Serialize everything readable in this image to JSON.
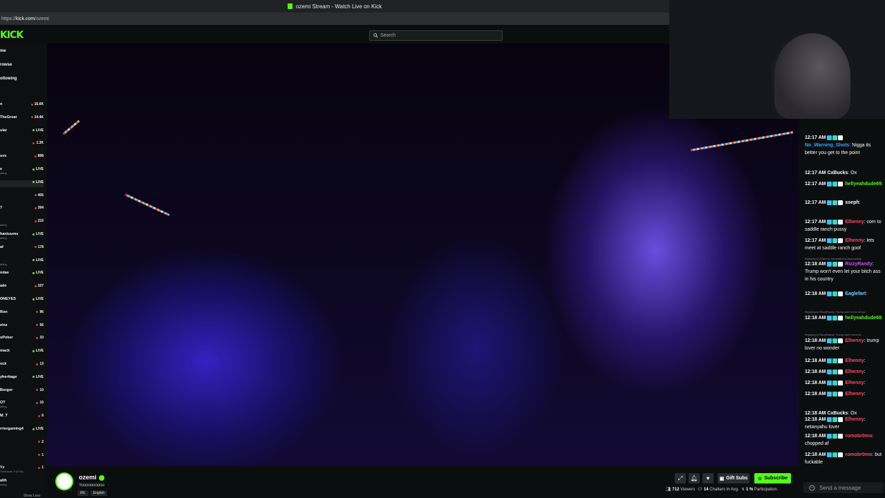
{
  "browser": {
    "title": "ozemi Stream - Watch Live on Kick",
    "url_prefix": "https://",
    "url_host": "kick.com",
    "url_path": "/ozemi"
  },
  "header": {
    "logo": "KICK",
    "search_placeholder": "Search"
  },
  "sidebar": {
    "nav": [
      "me",
      "rowse",
      "ollowing"
    ],
    "channels": [
      {
        "name": "n",
        "sub": "",
        "count": "16.6K",
        "dot": "red"
      },
      {
        "name": "TheGreat",
        "sub": "",
        "count": "14.4K",
        "dot": "red"
      },
      {
        "name": "ular",
        "sub": "",
        "count": "LIVE",
        "dot": "green"
      },
      {
        "name": "",
        "sub": "",
        "count": "1.3K",
        "dot": "red"
      },
      {
        "name": "uvs",
        "sub": "",
        "count": "898",
        "dot": "red"
      },
      {
        "name": "e",
        "sub": "atting",
        "count": "LIVE",
        "dot": "green"
      },
      {
        "name": "",
        "sub": "",
        "count": "LIVE",
        "dot": "green"
      },
      {
        "name": "",
        "sub": "",
        "count": "405",
        "dot": "red"
      },
      {
        "name": "7",
        "sub": "",
        "count": "394",
        "dot": "red"
      },
      {
        "name": "",
        "sub": "atting",
        "count": "215",
        "dot": "red"
      },
      {
        "name": "hantuums",
        "sub": "atting",
        "count": "LIVE",
        "dot": "green"
      },
      {
        "name": "af",
        "sub": "",
        "count": "178",
        "dot": "red"
      },
      {
        "name": "",
        "sub": "atting",
        "count": "LIVE",
        "dot": "green"
      },
      {
        "name": "ndas",
        "sub": "",
        "count": "LIVE",
        "dot": "green"
      },
      {
        "name": "ade",
        "sub": "",
        "count": "107",
        "dot": "red"
      },
      {
        "name": "ONEYES",
        "sub": "",
        "count": "LIVE",
        "dot": "green"
      },
      {
        "name": "Ron",
        "sub": "",
        "count": "96",
        "dot": "red"
      },
      {
        "name": "einz",
        "sub": "",
        "count": "56",
        "dot": "red"
      },
      {
        "name": "oPoker",
        "sub": "",
        "count": "33",
        "dot": "red"
      },
      {
        "name": "mack",
        "sub": "",
        "count": "LIVE",
        "dot": "green"
      },
      {
        "name": "ock",
        "sub": "",
        "count": "13",
        "dot": "red"
      },
      {
        "name": "yheritage",
        "sub": "",
        "count": "LIVE",
        "dot": "green"
      },
      {
        "name": "Borgor",
        "sub": "",
        "count": "10",
        "dot": "red"
      },
      {
        "name": "OT",
        "sub": "atting",
        "count": "10",
        "dot": "red"
      },
      {
        "name": "M_T",
        "sub": "",
        "count": "6",
        "dot": "red"
      },
      {
        "name": "rriorgaming4",
        "sub": "",
        "count": "LIVE",
        "dot": "green"
      },
      {
        "name": "",
        "sub": "",
        "count": "2",
        "dot": "red"
      },
      {
        "name": "",
        "sub": "",
        "count": "1",
        "dot": "red"
      },
      {
        "name": "Yz",
        "sub": "Theft Auto V (GTA)",
        "count": "1",
        "dot": "red"
      },
      {
        "name": "alth",
        "sub": "atting",
        "count": "",
        "dot": "none"
      }
    ],
    "show_less": "Show Less"
  },
  "stream": {
    "streamer": "ozemi",
    "title": "Yoooooooooo",
    "tags": [
      "IRL",
      "English"
    ],
    "gift_label": "Gift Subs",
    "subscribe_label": "Subscribe",
    "viewers": "712",
    "viewers_label": "Viewers",
    "chatters": "14",
    "chatters_label": "Chatters In Avg.",
    "participation": "1 %",
    "participation_label": "Participation"
  },
  "chat": {
    "messages": [
      {
        "time": "12:17 AM",
        "user": "No_Warning_Shots",
        "color": "#3aa0ff",
        "text": "Nigga its better you get to the point"
      },
      {
        "time": "12:17 AM",
        "user": "CxBucks",
        "color": "#ffffff",
        "text": "Ox"
      },
      {
        "time": "12:17 AM",
        "user": "hellyeahdude69",
        "color": "#53fc18",
        "text": ""
      },
      {
        "time": "12:17 AM",
        "user": "sseph",
        "color": "#ffffff",
        "text": ""
      },
      {
        "time": "12:17 AM",
        "user": "Elhenny",
        "color": "#ff4a6a",
        "text": "com to saddle ranch pussy"
      },
      {
        "time": "12:17 AM",
        "user": "Elhenny",
        "color": "#ff4a6a",
        "text": "lets meet at saddle ranch goof"
      },
      {
        "time": "12:18 AM",
        "user": "RizzyRandy",
        "color": "#d24aff",
        "text": "Trump won't even let your bitch ass in his country"
      },
      {
        "time": "12:18 AM",
        "user": "Eaglefart",
        "color": "#6ad6ff",
        "text": ""
      },
      {
        "time": "12:18 AM",
        "user": "hellyeahdude69",
        "color": "#53fc18",
        "text": ""
      },
      {
        "time": "12:18 AM",
        "user": "Elhenny",
        "color": "#ff4a6a",
        "text": "trump lover no wonder"
      },
      {
        "time": "12:18 AM",
        "user": "Elhenny",
        "color": "#ff4a6a",
        "text": ""
      },
      {
        "time": "12:18 AM",
        "user": "Elhenny",
        "color": "#ff4a6a",
        "text": ""
      },
      {
        "time": "12:18 AM",
        "user": "Elhenny",
        "color": "#ff4a6a",
        "text": ""
      },
      {
        "time": "12:18 AM",
        "user": "Elhenny",
        "color": "#ff4a6a",
        "text": ""
      },
      {
        "time": "12:18 AM",
        "user": "CxBucks",
        "color": "#ffffff",
        "text": "Ox"
      },
      {
        "time": "12:18 AM",
        "user": "Elhenny",
        "color": "#ff4a6a",
        "text": "netanyahu lover"
      },
      {
        "time": "12:18 AM",
        "user": "romobr0mo",
        "color": "#ff4a6a",
        "text": "chopped af"
      },
      {
        "time": "12:18 AM",
        "user": "romobr0mo",
        "color": "#ff4a6a",
        "text": "but fuckable"
      }
    ],
    "replies": [
      "Replying to Elhenny: hahahahaha okay buddy",
      "Replying to RizzyRandy: Trump won't even let yo...",
      "Replying to RizzyRandy: Trump won't even let..."
    ],
    "input_placeholder": "Send a message"
  }
}
